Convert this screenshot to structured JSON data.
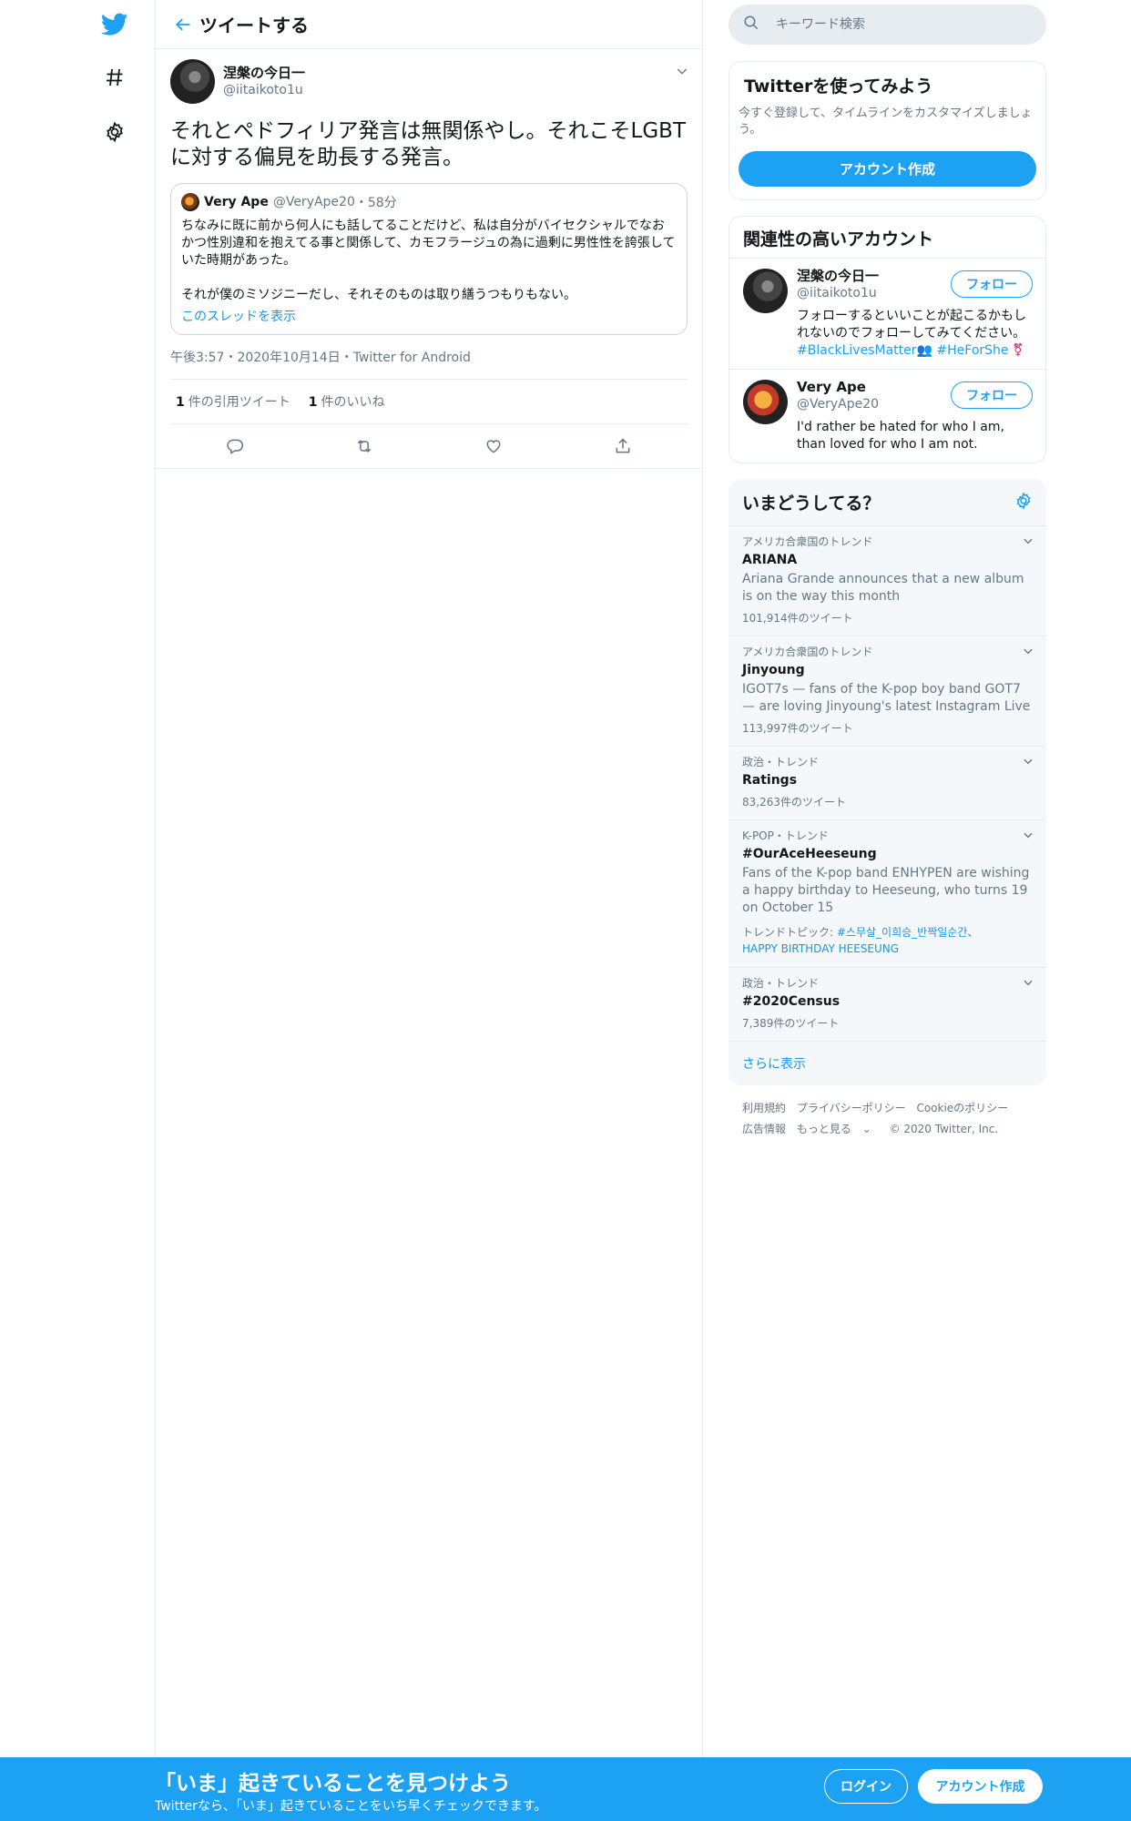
{
  "colors": {
    "accent": "#1da1f2",
    "text": "#14171a",
    "muted": "#657786",
    "border": "#e6ecf0"
  },
  "nav": {
    "icons": [
      "twitter-bird-icon",
      "hashtag-icon",
      "gear-icon"
    ]
  },
  "header": {
    "title": "ツイートする",
    "back_icon": "arrow-left-icon"
  },
  "tweet": {
    "author_name": "涅槃の今日一",
    "author_handle": "@iitaikoto1u",
    "text": "それとペドフィリア発言は無関係やし。それこそLGBTに対する偏見を助長する発言。",
    "quote": {
      "author_name": "Very Ape",
      "author_handle": "@VeryApe20",
      "time": "・58分",
      "paragraph1": "ちなみに既に前から何人にも話してることだけど、私は自分がバイセクシャルでなおかつ性別違和を抱えてる事と関係して、カモフラージュの為に過剰に男性性を誇張していた時期があった。",
      "paragraph2": "それが僕のミソジニーだし、それそのものは取り繕うつもりもない。",
      "show_thread": "このスレッドを表示"
    },
    "timestamp": "午後3:57・2020年10月14日・Twitter for Android",
    "stats": {
      "quotes_count": "1",
      "quotes_label": "件の引用ツイート",
      "likes_count": "1",
      "likes_label": "件のいいね"
    },
    "actions": [
      "reply-icon",
      "retweet-icon",
      "like-icon",
      "share-icon"
    ]
  },
  "search": {
    "placeholder": "キーワード検索"
  },
  "signup_card": {
    "title": "Twitterを使ってみよう",
    "description": "今すぐ登録して、タイムラインをカスタマイズしましょう。",
    "button": "アカウント作成"
  },
  "who_to_follow": {
    "title": "関連性の高いアカウント",
    "accounts": [
      {
        "name": "涅槃の今日一",
        "handle": "@iitaikoto1u",
        "bio": "フォローするといいことが起こるかもしれないのでフォローしてみてください。",
        "bio_tag1": "#BlackLivesMatter",
        "bio_emoji": "👥",
        "bio_tag2": "#HeForShe",
        "bio_tail": "⚧",
        "follow": "フォロー"
      },
      {
        "name": "Very Ape",
        "handle": "@VeryApe20",
        "bio": "I'd rather be hated for who I am, than loved for who I am not.",
        "follow": "フォロー"
      }
    ]
  },
  "trends": {
    "title": "いまどうしてる？",
    "items": [
      {
        "context": "アメリカ合衆国のトレンド",
        "name": "ARIANA",
        "desc": "Ariana Grande announces that a new album is on the way this month",
        "count": "101,914件のツイート"
      },
      {
        "context": "アメリカ合衆国のトレンド",
        "name": "Jinyoung",
        "desc": "IGOT7s — fans of the K-pop boy band GOT7 — are loving Jinyoung's latest Instagram Live",
        "count": "113,997件のツイート"
      },
      {
        "context": "政治・トレンド",
        "name": "Ratings",
        "count": "83,263件のツイート"
      },
      {
        "context": "K-POP・トレンド",
        "name": "#OurAceHeeseung",
        "desc": "Fans of the K-pop band ENHYPEN are wishing a happy birthday to Heeseung, who turns 19 on October 15",
        "topics_label": "トレンドトピック: ",
        "topic1": "#스무살_이희승_반짝일순간",
        "topic_sep": "、",
        "topic2": "HAPPY BIRTHDAY HEESEUNG"
      },
      {
        "context": "政治・トレンド",
        "name": "#2020Census",
        "count": "7,389件のツイート"
      }
    ],
    "show_more": "さらに表示"
  },
  "footer": {
    "links": [
      "利用規約",
      "プライバシーポリシー",
      "Cookieのポリシー",
      "広告情報",
      "もっと見る"
    ],
    "copyright": "© 2020 Twitter, Inc."
  },
  "bottom_bar": {
    "title": "「いま」起きていることを見つけよう",
    "subtitle": "Twitterなら、「いま」起きていることをいち早くチェックできます。",
    "login": "ログイン",
    "signup": "アカウント作成"
  }
}
